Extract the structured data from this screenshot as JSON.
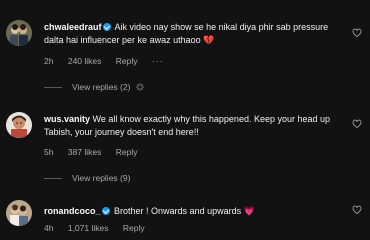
{
  "comments": [
    {
      "username": "chwaleedrauf",
      "verified": true,
      "text": "Aik video nay show se he nikal diya phir sab pressure dalta hai influencer per ke awaz uthaoo",
      "emoji": "💔",
      "time": "2h",
      "likes": "240 likes",
      "reply": "Reply",
      "more": "···"
    },
    {
      "username": "wus.vanity",
      "verified": false,
      "text": "We all know exactly why this happened. Keep your head up Tabish, your journey doesn't end here!!",
      "emoji": "",
      "time": "5h",
      "likes": "387 likes",
      "reply": "Reply"
    },
    {
      "username": "ronandcoco_",
      "verified": true,
      "text": "Brother ! Onwards and upwards",
      "emoji": "💗",
      "time": "4h",
      "likes": "1,071 likes",
      "reply": "Reply"
    }
  ],
  "replies": [
    {
      "label": "View replies (2)"
    },
    {
      "label": "View replies (9)"
    }
  ],
  "icons": {
    "like": "heart-outline-icon",
    "verified": "verified-badge-icon"
  },
  "colors": {
    "background": "#121212",
    "verified": "#1d9bf0",
    "secondary_text": "#a8a8a8"
  }
}
